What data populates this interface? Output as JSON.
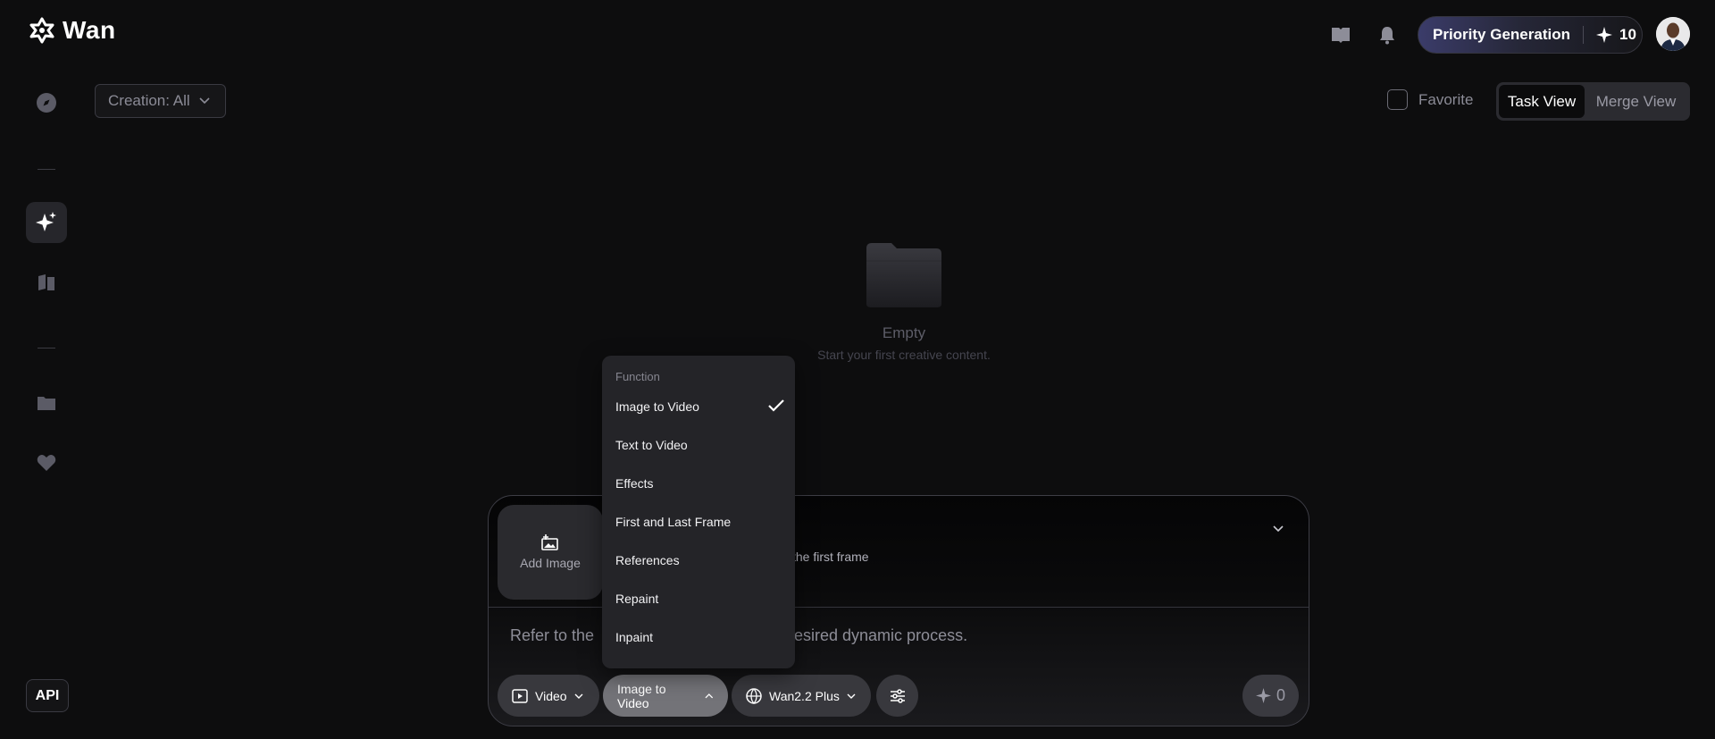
{
  "header": {
    "logo_text": "Wan",
    "priority_label": "Priority Generation",
    "credits": "10",
    "icons": [
      "book-icon",
      "bell-icon"
    ]
  },
  "sidebar": {
    "items": [
      "compass-icon",
      "sparkle-icon",
      "library-icon",
      "folder-icon",
      "heart-icon"
    ],
    "active": "sparkle-icon",
    "api_label": "API"
  },
  "filters": {
    "creation_label": "Creation: All",
    "favorite_label": "Favorite",
    "views": [
      "Task View",
      "Merge View"
    ],
    "active_view": "Task View"
  },
  "empty_state": {
    "title": "Empty",
    "subtitle": "Start your first creative content."
  },
  "composer": {
    "add_image_label": "Add Image",
    "first_frame_hint": "the first frame",
    "prompt_start": "Refer to the",
    "prompt_end": "esired dynamic process.",
    "mode_label": "Video",
    "function_label": "Image to Video",
    "model_label": "Wan2.2 Plus",
    "cost": "0"
  },
  "function_menu": {
    "header": "Function",
    "items": [
      "Image to Video",
      "Text to Video",
      "Effects",
      "First and Last Frame",
      "References",
      "Repaint",
      "Inpaint"
    ],
    "selected": "Image to Video"
  },
  "colors": {
    "background": "#0d0d0e",
    "accent_gradient_start": "#3b3c6a",
    "menu_bg": "#242428"
  }
}
